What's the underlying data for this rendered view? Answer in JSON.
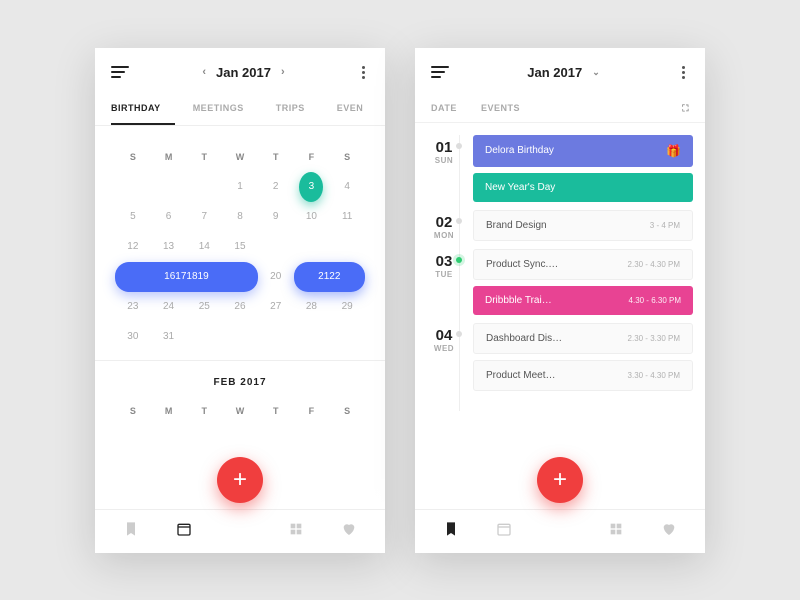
{
  "left": {
    "header_month": "Jan 2017",
    "tabs": [
      "BIRTHDAY",
      "MEETINGS",
      "TRIPS",
      "EVEN"
    ],
    "dow": [
      "S",
      "M",
      "T",
      "W",
      "T",
      "F",
      "S"
    ],
    "month1_pre": [
      "",
      "",
      ""
    ],
    "month1_days": [
      "1",
      "2",
      "3",
      "4",
      "5",
      "6",
      "7",
      "8",
      "9",
      "10",
      "11",
      "12",
      "13",
      "14",
      "15",
      "16",
      "17",
      "18",
      "19",
      "20",
      "21",
      "22",
      "23",
      "24",
      "25",
      "26",
      "27",
      "28",
      "29",
      "30",
      "31"
    ],
    "month2_label": "FEB 2017"
  },
  "right": {
    "header_month": "Jan 2017",
    "col_date": "DATE",
    "col_events": "EVENTS",
    "days": [
      {
        "num": "01",
        "wd": "SUN",
        "dot": "",
        "events": [
          {
            "style": "blue",
            "title": "Delora Birthday",
            "time": "",
            "icon": "gift"
          },
          {
            "style": "teal",
            "title": "New Year's Day",
            "time": ""
          }
        ]
      },
      {
        "num": "02",
        "wd": "MON",
        "dot": "",
        "events": [
          {
            "style": "gray",
            "title": "Brand Design",
            "time": "3 - 4 PM"
          }
        ]
      },
      {
        "num": "03",
        "wd": "TUE",
        "dot": "green",
        "events": [
          {
            "style": "gray",
            "title": "Product Sync.…",
            "time": "2.30 - 4.30 PM"
          },
          {
            "style": "pink",
            "title": "Dribbble Trai…",
            "time": "4.30 - 6.30 PM"
          }
        ]
      },
      {
        "num": "04",
        "wd": "WED",
        "dot": "",
        "events": [
          {
            "style": "gray",
            "title": "Dashboard Dis…",
            "time": "2.30 - 3.30 PM"
          },
          {
            "style": "gray",
            "title": "Product Meet…",
            "time": "3.30 - 4.30 PM"
          }
        ]
      }
    ]
  }
}
